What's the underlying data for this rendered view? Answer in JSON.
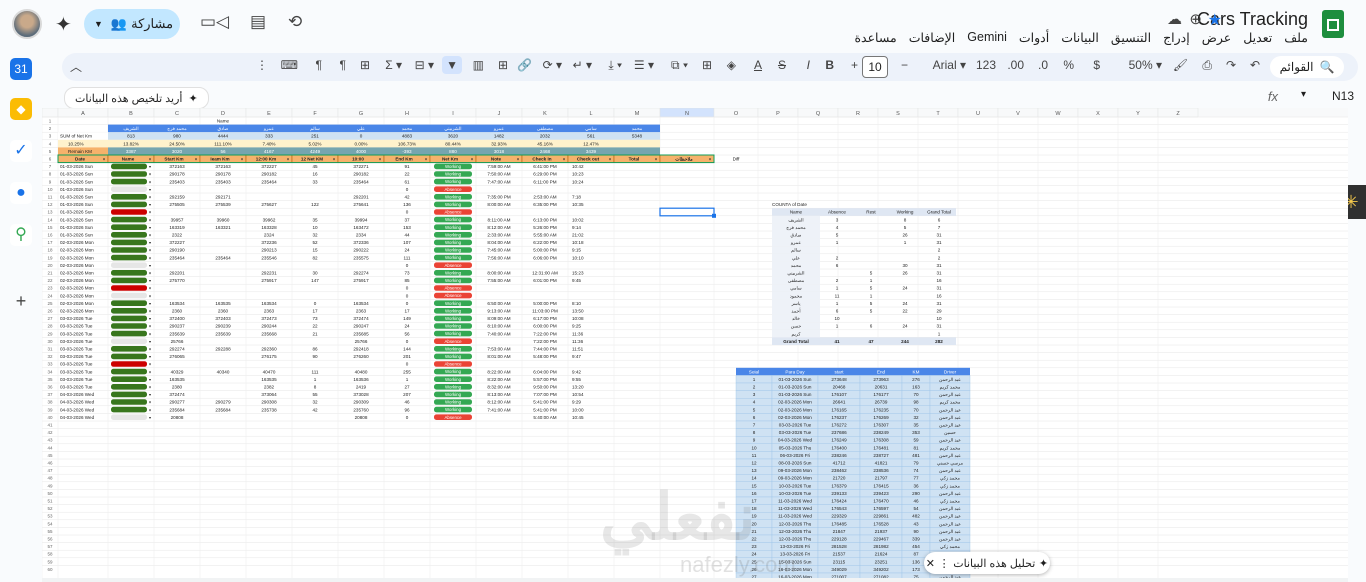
{
  "app": {
    "title": "Cars Tracking",
    "menus": [
      "ملف",
      "تعديل",
      "عرض",
      "إدراج",
      "التنسيق",
      "البيانات",
      "أدوات",
      "Gemini",
      "الإضافات",
      "مساعدة"
    ],
    "share_label": "مشاركة"
  },
  "toolbar": {
    "search_label": "القوائم",
    "zoom": "50%",
    "currency": "$",
    "percent": "%",
    "dec_less": ".0",
    "dec_more": ".00",
    "num_format": "123",
    "font": "Arial",
    "font_size": "10",
    "bold": "B",
    "italic": "I"
  },
  "formula_bar": {
    "name_box": "N13",
    "fx": "fx",
    "summarize_label": "أريد تلخيص هذه البيانات"
  },
  "gemini_toast": {
    "label": "تحليل هذه البيانات"
  },
  "columns": [
    "",
    "A",
    "B",
    "C",
    "D",
    "E",
    "F",
    "G",
    "H",
    "I",
    "J",
    "K",
    "L",
    "M",
    "N",
    "O",
    "P",
    "Q",
    "R",
    "S",
    "T",
    "U",
    "V",
    "W",
    "X",
    "Y",
    "Z"
  ],
  "sheet": {
    "row1": [
      "",
      "",
      "",
      "",
      "Name",
      "",
      "",
      "",
      "",
      "",
      "",
      "",
      "",
      "",
      "",
      ""
    ],
    "summary_labels": [
      "SUM of Net Km",
      "10.25%",
      "Remain KM"
    ],
    "summary_values_row3": [
      "",
      "813",
      "980",
      "4444",
      "333",
      "251",
      "0",
      "4883",
      "3620",
      "1482",
      "2032",
      "561",
      "5348"
    ],
    "summary_values_row4": [
      "",
      "13.82%",
      "24.50%",
      "111.10%",
      "7.40%",
      "5.02%",
      "0.00%",
      "106.73%",
      "80.44%",
      "32.93%",
      "45.16%",
      "12.47%",
      ""
    ],
    "summary_values_row5": [
      "",
      "3387",
      "3020",
      "56",
      "4167",
      "4249",
      "4000",
      "-393",
      "880",
      "3018",
      "2468",
      "3439",
      ""
    ],
    "names_row2": [
      "",
      "الشريف",
      "محمد فرج",
      "صادق",
      "عمرو",
      "سالم",
      "علي",
      "محمد",
      "الشربيني",
      "عمرو",
      "مصطفى",
      "سامي",
      "محمد"
    ],
    "headers": [
      "Date",
      "Name",
      "Start Km",
      "Ieam Km",
      "12:00 Km",
      "12 Net KM",
      "10:00",
      "End Km",
      "Net Km",
      "Note",
      "Check in",
      "Check out",
      "Total",
      "ملاحظات"
    ],
    "rows": [
      [
        "01-03-2026 Sun",
        "372163",
        "372163",
        "372227",
        "45",
        "372271",
        "91",
        "Working",
        "7:59:00 AM",
        "6:41:00 PM",
        "10:42"
      ],
      [
        "01-03-2026 Sun",
        "290178",
        "290178",
        "290182",
        "16",
        "290182",
        "22",
        "Working",
        "7:50:00 AM",
        "6:29:00 PM",
        "10:23"
      ],
      [
        "01-03-2026 Sun",
        "235403",
        "235403",
        "235464",
        "33",
        "235464",
        "61",
        "Working",
        "7:47:00 AM",
        "6:11:00 PM",
        "10:24"
      ],
      [
        "01-03-2026 Sun",
        "",
        "",
        "",
        "",
        "",
        "0",
        "Absence",
        "",
        "",
        ""
      ],
      [
        "01-03-2026 Sun",
        "292159",
        "292171",
        "",
        "",
        "292201",
        "42",
        "Working",
        "7:35:00 PM",
        "2:53:00 AM",
        "7:18"
      ],
      [
        "01-03-2026 Sun",
        "275505",
        "275539",
        "275627",
        "122",
        "275641",
        "136",
        "Working",
        "8:00:00 AM",
        "6:35:00 PM",
        "10:35"
      ],
      [
        "01-03-2026 Sun",
        "",
        "",
        "",
        "",
        "",
        "0",
        "Absence",
        "",
        "",
        ""
      ],
      [
        "01-03-2026 Sun",
        "39957",
        "39960",
        "39962",
        "35",
        "39994",
        "37",
        "Working",
        "8:11:00 AM",
        "6:13:00 PM",
        "10:02"
      ],
      [
        "01-03-2026 Sun",
        "163319",
        "163321",
        "163328",
        "10",
        "163472",
        "153",
        "Working",
        "8:12:00 AM",
        "5:26:00 PM",
        "9:14"
      ],
      [
        "01-03-2026 Sun",
        "2322",
        "",
        "2324",
        "32",
        "2334",
        "44",
        "Working",
        "2:33:00 AM",
        "5:55:00 AM",
        "21:02"
      ],
      [
        "02-03-2026 Mon",
        "372227",
        "",
        "372236",
        "52",
        "372336",
        "107",
        "Working",
        "8:04:00 AM",
        "6:22:00 PM",
        "10:18"
      ],
      [
        "02-03-2026 Mon",
        "290190",
        "",
        "290213",
        "15",
        "290222",
        "24",
        "Working",
        "7:45:00 AM",
        "5:00:00 PM",
        "9:15"
      ],
      [
        "02-03-2026 Mon",
        "235464",
        "235464",
        "235546",
        "82",
        "235575",
        "111",
        "Working",
        "7:56:00 AM",
        "6:06:00 PM",
        "10:10"
      ],
      [
        "02-03-2026 Mon",
        "",
        "",
        "",
        "",
        "",
        "0",
        "Absence",
        "",
        "",
        ""
      ],
      [
        "02-03-2026 Mon",
        "292201",
        "",
        "292231",
        "30",
        "292274",
        "73",
        "Working",
        "8:00:00 AM",
        "12:31:00 AM",
        "15:23"
      ],
      [
        "02-03-2026 Mon",
        "275770",
        "",
        "275917",
        "147",
        "275917",
        "85",
        "Working",
        "7:55:00 AM",
        "6:01:00 PM",
        "9:45"
      ],
      [
        "02-03-2026 Mon",
        "",
        "",
        "",
        "",
        "",
        "0",
        "Absence",
        "",
        "",
        ""
      ],
      [
        "02-03-2026 Mon",
        "",
        "",
        "",
        "",
        "",
        "0",
        "Absence",
        "",
        "",
        ""
      ],
      [
        "02-03-2026 Mon",
        "163534",
        "163535",
        "163534",
        "0",
        "163534",
        "0",
        "Working",
        "6:50:00 AM",
        "5:00:00 PM",
        "8:10"
      ],
      [
        "02-03-2026 Mon",
        "2360",
        "2360",
        "2363",
        "17",
        "2363",
        "17",
        "Working",
        "9:13:00 AM",
        "11:03:00 PM",
        "13:50"
      ],
      [
        "03-03-2026 Tue",
        "372400",
        "372403",
        "372473",
        "73",
        "372474",
        "149",
        "Working",
        "8:09:00 AM",
        "6:17:00 PM",
        "10:08"
      ],
      [
        "03-03-2026 Tue",
        "290237",
        "290239",
        "290244",
        "22",
        "290247",
        "24",
        "Working",
        "8:10:00 AM",
        "6:00:00 PM",
        "9:25"
      ],
      [
        "03-03-2026 Tue",
        "235639",
        "235639",
        "235668",
        "21",
        "235685",
        "56",
        "Working",
        "7:40:00 AM",
        "7:22:00 PM",
        "11:36"
      ],
      [
        "03-03-2026 Tue",
        "25766",
        "",
        "",
        "",
        "25766",
        "0",
        "Absence",
        "",
        "7:22:00 PM",
        "11:36"
      ],
      [
        "03-03-2026 Tue",
        "292274",
        "292288",
        "292360",
        "86",
        "292418",
        "144",
        "Working",
        "7:53:00 AM",
        "7:44:00 PM",
        "11:51"
      ],
      [
        "03-03-2026 Tue",
        "276065",
        "",
        "276175",
        "90",
        "276260",
        "201",
        "Working",
        "8:01:00 AM",
        "5:48:00 PM",
        "9:47"
      ],
      [
        "03-03-2026 Tue",
        "",
        "",
        "",
        "",
        "",
        "0",
        "Absence",
        "",
        "",
        ""
      ],
      [
        "03-03-2026 Tue",
        "40329",
        "40340",
        "40470",
        "111",
        "40480",
        "255",
        "Working",
        "8:22:00 AM",
        "6:04:00 PM",
        "9:42"
      ],
      [
        "03-03-2026 Tue",
        "163535",
        "",
        "163535",
        "1",
        "163536",
        "1",
        "Working",
        "8:22:00 AM",
        "5:57:00 PM",
        "9:55"
      ],
      [
        "03-03-2026 Tue",
        "2380",
        "",
        "2382",
        "8",
        "2419",
        "27",
        "Working",
        "8:32:00 AM",
        "9:50:00 PM",
        "13:20"
      ],
      [
        "04-03-2026 Wed",
        "372474",
        "",
        "373064",
        "55",
        "373028",
        "207",
        "Working",
        "8:13:00 AM",
        "7:07:00 PM",
        "10:54"
      ],
      [
        "04-03-2026 Wed",
        "290277",
        "290279",
        "290308",
        "32",
        "290309",
        "46",
        "Working",
        "8:12:00 AM",
        "5:41:00 PM",
        "9:29"
      ],
      [
        "04-03-2026 Wed",
        "235684",
        "235684",
        "235738",
        "42",
        "235760",
        "96",
        "Working",
        "7:41:00 AM",
        "5:41:00 PM",
        "10:00"
      ],
      [
        "04-03-2026 Wed",
        "20808",
        "",
        "",
        "",
        "20808",
        "0",
        "Absence",
        "",
        "5:40:00 AM",
        "10:45"
      ]
    ]
  },
  "pivot1": {
    "title": "COUNTA of Date",
    "headers": [
      "Name",
      "Absence",
      "Rest",
      "Working",
      "Grand Total"
    ],
    "rows": [
      [
        "الشريف",
        "3",
        "",
        "8",
        "6"
      ],
      [
        "محمد فرج",
        "4",
        "",
        "5",
        "7"
      ],
      [
        "صادق",
        "5",
        "",
        "26",
        "31"
      ],
      [
        "عمرو",
        "1",
        "",
        "1",
        "31"
      ],
      [
        "سالم",
        "",
        "",
        "",
        "2"
      ],
      [
        "علي",
        "2",
        "",
        "",
        "2"
      ],
      [
        "محمد",
        "6",
        "",
        "30",
        "31"
      ],
      [
        "الشربيني",
        "",
        "5",
        "26",
        "31"
      ],
      [
        "مصطفى",
        "2",
        "1",
        "",
        "16"
      ],
      [
        "سامي",
        "1",
        "5",
        "24",
        "31"
      ],
      [
        "محمود",
        "11",
        "1",
        "",
        "16"
      ],
      [
        "ياسر",
        "1",
        "5",
        "24",
        "31"
      ],
      [
        "أحمد",
        "6",
        "5",
        "22",
        "29"
      ],
      [
        "خالد",
        "10",
        "",
        "",
        "10"
      ],
      [
        "حسن",
        "1",
        "6",
        "24",
        "31"
      ],
      [
        "كريم",
        "",
        "",
        "",
        "1"
      ]
    ],
    "total": [
      "Grand Total",
      "41",
      "47",
      "244",
      "282"
    ]
  },
  "pivot2": {
    "headers": [
      "Seial",
      "Para Day",
      "start",
      "End",
      "KM",
      "Driver"
    ],
    "rows": [
      [
        "1",
        "01-03-2026 Sun",
        "273648",
        "273963",
        "276",
        "عبد الرحمن"
      ],
      [
        "2",
        "01-03-2026 Sun",
        "20468",
        "20631",
        "163",
        "محمد كريم"
      ],
      [
        "3",
        "01-03-2026 Sun",
        "176107",
        "176177",
        "70",
        "عبد الرحمن"
      ],
      [
        "4",
        "02-03-2026 Mon",
        "26641",
        "26739",
        "98",
        "محمد كريم"
      ],
      [
        "5",
        "02-03-2026 Mon",
        "176165",
        "176235",
        "70",
        "عبد الرحمن"
      ],
      [
        "6",
        "02-03-2026 Mon",
        "176237",
        "176269",
        "32",
        "عبد الرحمن"
      ],
      [
        "7",
        "03-03-2026 Tue",
        "176272",
        "176307",
        "35",
        "عبد الرحمن"
      ],
      [
        "8",
        "03-03-2026 Tue",
        "237686",
        "238249",
        "353",
        "حسين"
      ],
      [
        "9",
        "04-03-2026 Wed",
        "176249",
        "176308",
        "59",
        "عبد الرحمن"
      ],
      [
        "10",
        "05-03-2026 Thu",
        "176400",
        "176481",
        "81",
        "محمد كريم"
      ],
      [
        "11",
        "06-03-2026 Fri",
        "238246",
        "238727",
        "481",
        "عبد الرحمن"
      ],
      [
        "12",
        "08-03-2026 Sun",
        "41712",
        "41821",
        "79",
        "مرسي حسني"
      ],
      [
        "13",
        "09-03-2026 Mon",
        "238462",
        "238536",
        "74",
        "عبد الرحمن"
      ],
      [
        "14",
        "09-03-2026 Mon",
        "21720",
        "21797",
        "77",
        "محمد زكي"
      ],
      [
        "15",
        "10-03-2026 Tue",
        "176379",
        "176415",
        "36",
        "محمد زكي"
      ],
      [
        "16",
        "10-03-2026 Tue",
        "239133",
        "239423",
        "290",
        "عبد الرحمن"
      ],
      [
        "17",
        "11-03-2026 Wed",
        "176424",
        "176470",
        "46",
        "محمد زكي"
      ],
      [
        "18",
        "11-03-2026 Wed",
        "176543",
        "176597",
        "54",
        "عبد الرحمن"
      ],
      [
        "19",
        "11-03-2026 Wed",
        "229329",
        "229861",
        "482",
        "عبد الرحمن"
      ],
      [
        "20",
        "12-03-2026 Thu",
        "176485",
        "176528",
        "43",
        "عبد الرحمن"
      ],
      [
        "21",
        "12-03-2026 Thu",
        "21847",
        "21937",
        "90",
        "عبد الرحمن"
      ],
      [
        "22",
        "12-03-2026 Thu",
        "229128",
        "229467",
        "339",
        "عبد الرحمن"
      ],
      [
        "23",
        "13-03-2026 Fri",
        "281528",
        "281982",
        "454",
        "محمد زكي"
      ],
      [
        "24",
        "13-03-2026 Fri",
        "21537",
        "21624",
        "87",
        "عبد الرحمن"
      ],
      [
        "25",
        "15-03-2026 Sun",
        "23115",
        "23251",
        "136",
        "عبد الرحمن"
      ],
      [
        "26",
        "16-03-2026 Mon",
        "349029",
        "349202",
        "173",
        "عبد الرحمن"
      ],
      [
        "27",
        "16-03-2026 Mon",
        "271007",
        "271082",
        "75",
        "عبد الرحمن"
      ]
    ]
  },
  "colors": {
    "working": "#34a853",
    "absence": "#ea4335",
    "header_orange": "#f6b26b",
    "name_blue": "#4a86e8",
    "pivot_blue": "#9fc5e8",
    "pill_green": "#38761d"
  },
  "icons": [
    "sheets-logo-icon",
    "star-icon",
    "cloud-icon",
    "history-icon",
    "comment-icon",
    "video-icon",
    "gemini-icon",
    "lock-icon"
  ]
}
